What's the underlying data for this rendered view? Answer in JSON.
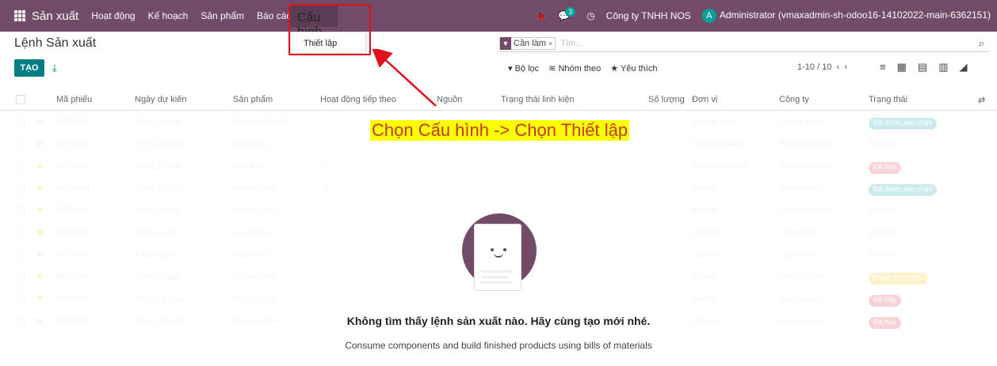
{
  "topbar": {
    "brand": "Sản xuất",
    "menu": [
      "Hoạt động",
      "Kế hoạch",
      "Sản phẩm",
      "Báo cáo"
    ],
    "active_menu": "Cấu hình",
    "message_count": "3",
    "company": "Công ty TNHH NOS",
    "avatar_letter": "A",
    "user": "Administrator (vmaxadmin-sh-odoo16-14102022-main-6362151)"
  },
  "dropdown": {
    "item": "Thiết lập"
  },
  "page": {
    "title": "Lệnh Sản xuất",
    "create_label": "TẠO"
  },
  "search": {
    "facet": "Cần làm",
    "placeholder": "Tìm..."
  },
  "filters": {
    "filter": "Bộ lọc",
    "group": "Nhóm theo",
    "favorite": "Yêu thích"
  },
  "pager": "1-10 / 10",
  "table": {
    "headers": [
      "Mã phiếu",
      "Ngày dự kiến",
      "Sản phẩm",
      "Hoạt động tiếp theo",
      "Nguồn",
      "Trạng thái linh kiện",
      "Số lượng",
      "Đơn vị",
      "Công ty",
      "Trạng thái"
    ],
    "rows": [
      {
        "ref": "REF0001",
        "date": "Trong 3 ngày",
        "product": "Voluptat blandit",
        "uom": "Voyaris nam",
        "company": "Integer vitae",
        "status": "Đã được xác nhận"
      },
      {
        "ref": "REF0002",
        "date": "Trong 31 ngày",
        "product": "Laoreet id",
        "uom": "Voluptat blandit",
        "company": "Voluptat blandit",
        "status": "Dự thảo"
      },
      {
        "ref": "REF0003",
        "date": "Trong 7 ngày",
        "product": "In dolore",
        "uom": "Voluptat blandit",
        "company": "Voluptat blandit",
        "status": "Đã hủy"
      },
      {
        "ref": "REF0004",
        "date": "Trong 11 ngày",
        "product": "Viverra nam",
        "uom": "Viverra",
        "company": "Viverra nam",
        "status": "Đã được xác nhận"
      },
      {
        "ref": "REF0005",
        "date": "Trong 2 ngày",
        "product": "Integer vitae",
        "uom": "Integer",
        "company": "Voluptat blandit",
        "status": "Dự thảo"
      },
      {
        "ref": "REF0006",
        "date": "11 days ago",
        "product": "Laoreet id",
        "uom": "Laoreet",
        "company": "Laoreet id",
        "status": "Dự thảo"
      },
      {
        "ref": "REF0007",
        "date": "4 days ago",
        "product": "Laoreet id",
        "uom": "Laoreet",
        "company": "Laoreet id",
        "status": "Dự thảo"
      },
      {
        "ref": "REF0008",
        "date": "Trong 7 ngày",
        "product": "Integer vitae",
        "uom": "Integer",
        "company": "Integer vitae",
        "status": "Đang thực hiện"
      },
      {
        "ref": "REF0009",
        "date": "Trong 25 ngày",
        "product": "Viverra nam",
        "uom": "Viverra",
        "company": "Viverra nam",
        "status": "Đã hủy"
      },
      {
        "ref": "REF0010",
        "date": "Trong 42 ngày",
        "product": "Viverra nam",
        "uom": "Viverra",
        "company": "Viverra nam",
        "status": "Đã hủy"
      }
    ]
  },
  "help": {
    "title": "Không tìm thấy lệnh sản xuất nào. Hãy cùng tạo mới nhé.",
    "subtitle": "Consume components and build finished products using bills of materials"
  },
  "annotation": "Chọn Cấu hình -> Chọn Thiết lập",
  "colors": {
    "primary": "#714B67",
    "accent": "#017E84",
    "annotation": "#e0101c"
  }
}
